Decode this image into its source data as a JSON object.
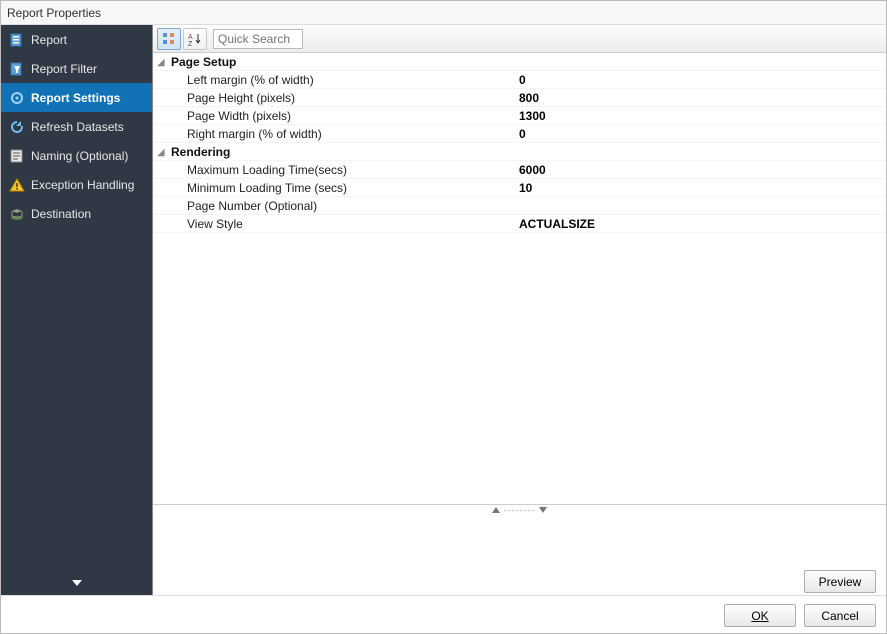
{
  "window": {
    "title": "Report Properties"
  },
  "sidebar": {
    "items": [
      {
        "label": "Report"
      },
      {
        "label": "Report Filter"
      },
      {
        "label": "Report Settings"
      },
      {
        "label": "Refresh Datasets"
      },
      {
        "label": "Naming (Optional)"
      },
      {
        "label": "Exception Handling"
      },
      {
        "label": "Destination"
      }
    ]
  },
  "toolbar": {
    "search_placeholder": "Quick Search"
  },
  "groups": {
    "page_setup": "Page Setup",
    "rendering": "Rendering"
  },
  "props": {
    "left_margin": {
      "label": "Left margin (% of width)",
      "value": "0"
    },
    "page_height": {
      "label": "Page Height (pixels)",
      "value": "800"
    },
    "page_width": {
      "label": "Page Width (pixels)",
      "value": "1300"
    },
    "right_margin": {
      "label": "Right margin (% of width)",
      "value": "0"
    },
    "max_load": {
      "label": "Maximum Loading Time(secs)",
      "value": "6000"
    },
    "min_load": {
      "label": "Minimum Loading Time (secs)",
      "value": "10"
    },
    "page_number": {
      "label": "Page Number (Optional)",
      "value": ""
    },
    "view_style": {
      "label": "View Style",
      "value": "ACTUALSIZE"
    }
  },
  "buttons": {
    "preview": "Preview",
    "ok": "OK",
    "cancel": "Cancel"
  }
}
